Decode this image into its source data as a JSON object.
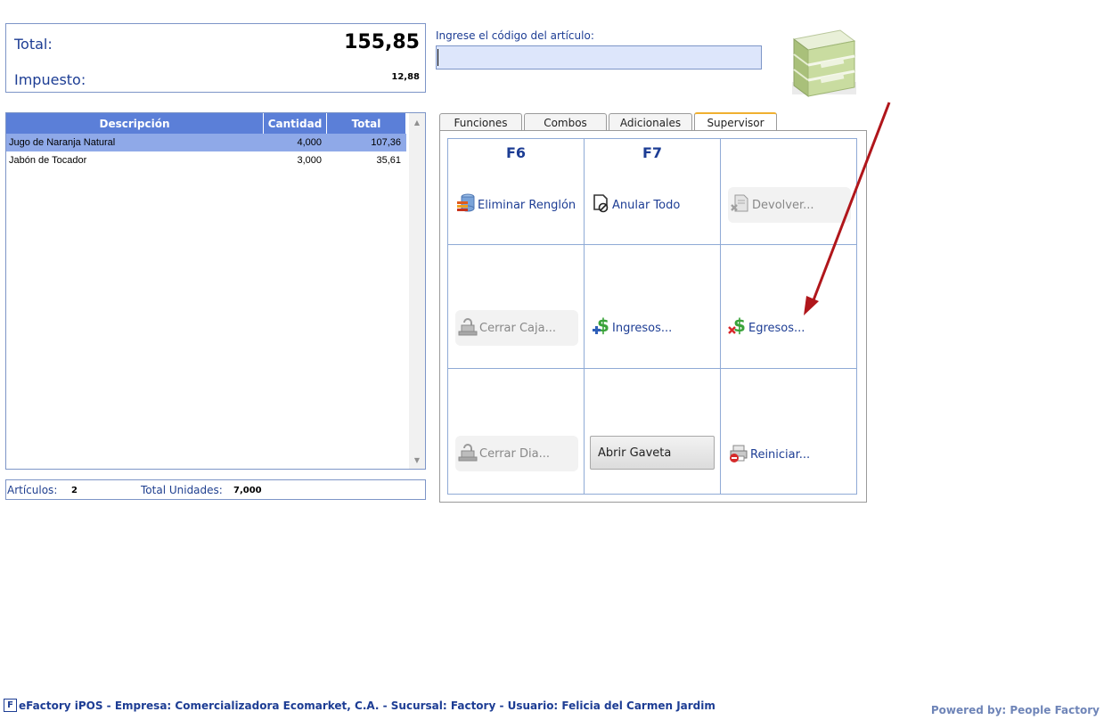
{
  "totals": {
    "total_label": "Total:",
    "total_value": "155,85",
    "tax_label": "Impuesto:",
    "tax_value": "12,88"
  },
  "code": {
    "label": "Ingrese el código del artículo:",
    "value": ""
  },
  "grid": {
    "columns": [
      "Descripción",
      "Cantidad",
      "Total"
    ],
    "rows": [
      {
        "descripcion": "Jugo de Naranja Natural",
        "cantidad": "4,000",
        "total": "107,36",
        "selected": true
      },
      {
        "descripcion": "Jabón de Tocador",
        "cantidad": "3,000",
        "total": "35,61",
        "selected": false
      }
    ]
  },
  "summary": {
    "articulos_label": "Artículos:",
    "articulos_value": "2",
    "unidades_label": "Total Unidades:",
    "unidades_value": "7,000"
  },
  "tabs": [
    {
      "label": "Funciones",
      "active": false
    },
    {
      "label": "Combos",
      "active": false
    },
    {
      "label": "Adicionales",
      "active": false
    },
    {
      "label": "Supervisor",
      "active": true
    }
  ],
  "buttons": {
    "f6": "F6",
    "f7": "F7",
    "eliminar_renglon": "Eliminar Renglón",
    "anular_todo": "Anular Todo",
    "devolver": "Devolver...",
    "cerrar_caja": "Cerrar Caja...",
    "ingresos": "Ingresos...",
    "egresos": "Egresos...",
    "cerrar_dia": "Cerrar Dia...",
    "abrir_gaveta": "Abrir Gaveta",
    "reiniciar": "Reiniciar..."
  },
  "status": {
    "logo": "F",
    "text": "eFactory iPOS - Empresa: Comercializadora Ecomarket, C.A. - Sucursal: Factory - Usuario: Felicia del Carmen Jardim",
    "powered_by": "Powered by: People Factory"
  },
  "colors": {
    "header_blue": "#5b7fd8",
    "selected_row": "#8fa9e8",
    "text_blue": "#1d3d94",
    "annotation_arrow": "#b0161b"
  }
}
